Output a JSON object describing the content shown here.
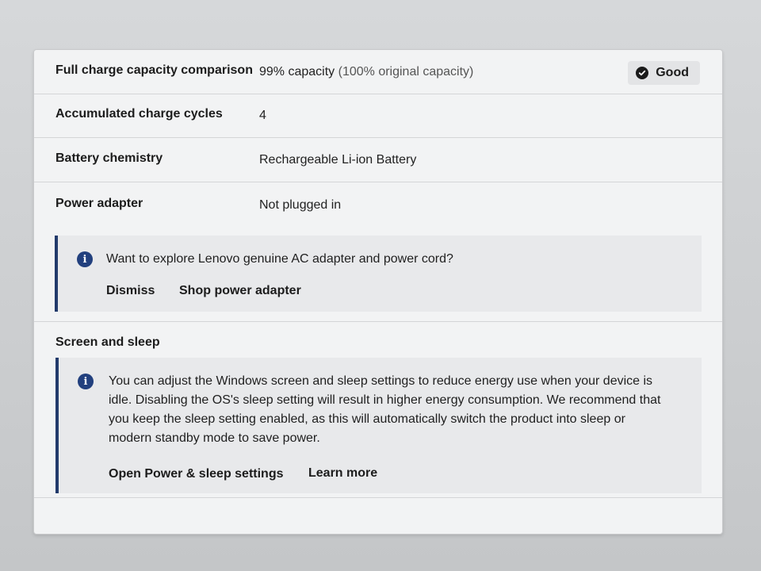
{
  "battery": {
    "rows": [
      {
        "label": "Full charge capacity comparison",
        "value": "99% capacity",
        "value_note": "(100% original capacity)"
      },
      {
        "label": "Accumulated charge cycles",
        "value": "4"
      },
      {
        "label": "Battery chemistry",
        "value": "Rechargeable Li-ion Battery"
      },
      {
        "label": "Power adapter",
        "value": "Not plugged in"
      }
    ],
    "status_badge": {
      "label": "Good",
      "icon": "check-circle-icon"
    }
  },
  "adapter_notice": {
    "icon": "info-icon",
    "text": "Want to explore Lenovo genuine AC adapter and power cord?",
    "dismiss_label": "Dismiss",
    "shop_label": "Shop power adapter"
  },
  "screen_sleep": {
    "title": "Screen and sleep",
    "notice_icon": "info-icon",
    "notice_lines": [
      "You can adjust the Windows screen and sleep settings to reduce energy use when your device is",
      "idle. Disabling the OS's sleep setting will result in higher energy consumption. We recommend that",
      "you keep the sleep setting enabled, as this will automatically switch the product into sleep or",
      "modern standby mode to save power."
    ],
    "open_settings_label": "Open Power & sleep settings",
    "learn_more_label": "Learn more"
  },
  "colors": {
    "accent": "#22407e",
    "notice_bar": "#223a6b",
    "panel_bg": "#f2f3f4"
  }
}
